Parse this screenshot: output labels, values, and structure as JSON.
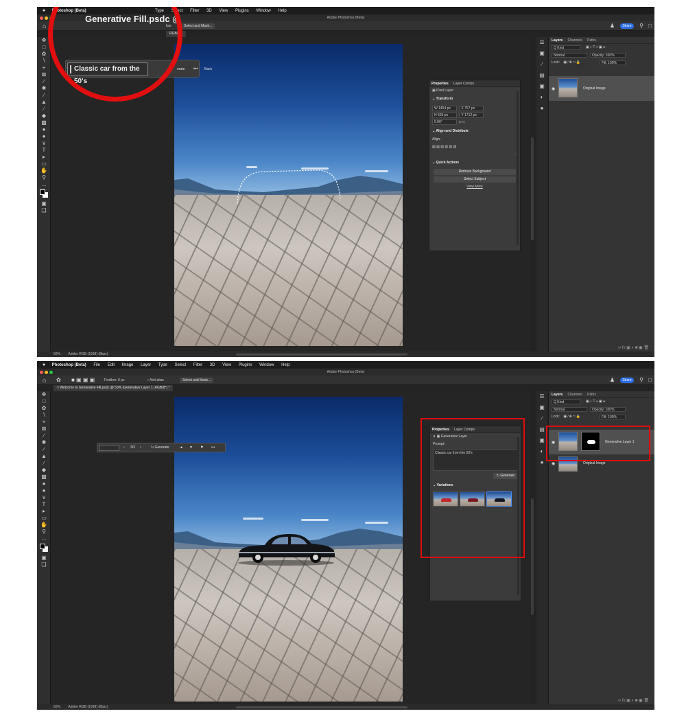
{
  "top": {
    "menu": {
      "apple": "",
      "app": "Photoshop (Beta)",
      "items": [
        "Type",
        "Select",
        "Filter",
        "3D",
        "View",
        "Plugins",
        "Window",
        "Help"
      ]
    },
    "big_title": "Generative Fill.psdc",
    "big_title_partial_icon": "@",
    "window_title": "Adobe Photoshop (Beta)",
    "options": {
      "partial_label": "lias",
      "select_mask": "Select and Mask...",
      "share": "Share"
    },
    "doc_tab_partial": "RGB/8*)",
    "prompt": {
      "value": "Classic car from the 50's",
      "generate": "erate",
      "more": "•••",
      "back": "Back"
    },
    "properties": {
      "tabs": [
        "Properties",
        "Layer Comps"
      ],
      "type": "Pixel Layer",
      "transform_heading": "Transform",
      "w": "W  1454 px",
      "h": "H  603 px",
      "x": "X  757 px",
      "y": "Y  1712 px",
      "angle": "0.00°",
      "align_heading": "Align and Distribute",
      "align_label": "Align:",
      "quick_heading": "Quick Actions",
      "remove_bg": "Remove Background",
      "select_subject": "Select Subject",
      "view_more": "View More"
    },
    "layers": {
      "tabs": [
        "Layers",
        "Channels",
        "Paths"
      ],
      "kind": "Q Kind",
      "blend": "Normal",
      "opacity": "Opacity: 100%",
      "lock": "Lock:",
      "fill": "Fill: 100%",
      "items": [
        "Original Image"
      ]
    },
    "status": {
      "zoom": "50%",
      "profile": "Adobe RGB (1998) (8bpc)"
    }
  },
  "bottom": {
    "menu": {
      "apple": "",
      "app": "Photoshop (Beta)",
      "items": [
        "File",
        "Edit",
        "Image",
        "Layer",
        "Type",
        "Select",
        "Filter",
        "3D",
        "View",
        "Plugins",
        "Window",
        "Help"
      ]
    },
    "window_title": "Adobe Photoshop (Beta)",
    "options": {
      "feather": "Feather:  0 px",
      "anti_alias": "Anti-alias",
      "select_mask": "Select and Mask...",
      "share": "Share"
    },
    "doc_tab": "Welcome to Generative Fill.psdc @ 50% (Generative Layer 1, RGB/8*) *",
    "taskbar": {
      "counter": "3/3",
      "generate": "Generate",
      "more": "•••"
    },
    "properties": {
      "tabs": [
        "Properties",
        "Layer Comps"
      ],
      "type": "Generative Layer",
      "prompt_label": "Prompt:",
      "prompt_value": "Classic car from the 50's",
      "generate": "Generate",
      "variations_heading": "Variations",
      "variation_colors": [
        "#c0262b",
        "#7a1b22",
        "#141720"
      ]
    },
    "layers": {
      "tabs": [
        "Layers",
        "Channels",
        "Paths"
      ],
      "kind": "Q Kind",
      "blend": "Normal",
      "opacity": "Opacity: 100%",
      "lock": "Lock:",
      "fill": "Fill: 100%",
      "items": [
        "Generative Layer 1",
        "Original Image"
      ]
    },
    "status": {
      "zoom": "50%",
      "profile": "Adobe RGB (1998) (8bpc)"
    }
  },
  "colors": {
    "highlight": "#e10f0f",
    "accent": "#2d6ee6",
    "chrome": "#232323"
  }
}
